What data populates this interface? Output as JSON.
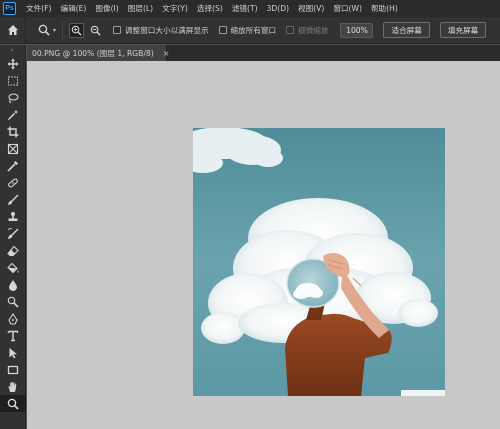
{
  "app": {
    "logo_text": "Ps"
  },
  "menu": {
    "items": [
      {
        "label": "文件(F)"
      },
      {
        "label": "编辑(E)"
      },
      {
        "label": "图像(I)"
      },
      {
        "label": "图层(L)"
      },
      {
        "label": "文字(Y)"
      },
      {
        "label": "选择(S)"
      },
      {
        "label": "滤镜(T)"
      },
      {
        "label": "3D(D)"
      },
      {
        "label": "视图(V)"
      },
      {
        "label": "窗口(W)"
      },
      {
        "label": "帮助(H)"
      }
    ]
  },
  "options": {
    "checkbox_resize": "调整窗口大小以满屏显示",
    "checkbox_zoom_all": "缩放所有窗口",
    "checkbox_scrubby": "细微缩放",
    "zoom_percent": "100%",
    "fit_screen": "适合屏幕",
    "fill_screen": "填充屏幕"
  },
  "document": {
    "tab_title": "00.PNG @ 100% (图层 1, RGB/8)",
    "tab_close": "×"
  },
  "tools": [
    "move-tool-icon",
    "marquee-tool-icon",
    "lasso-tool-icon",
    "magic-wand-tool-icon",
    "crop-tool-icon",
    "frame-tool-icon",
    "eyedropper-tool-icon",
    "healing-brush-tool-icon",
    "brush-tool-icon",
    "clone-stamp-tool-icon",
    "history-brush-tool-icon",
    "eraser-tool-icon",
    "paint-bucket-tool-icon",
    "blur-tool-icon",
    "dodge-tool-icon",
    "pen-tool-icon",
    "type-tool-icon",
    "path-selection-tool-icon",
    "rectangle-tool-icon",
    "hand-tool-icon",
    "zoom-tool-icon"
  ],
  "colors": {
    "accent": "#31a8ff",
    "sky": "#5e9aa6",
    "shirt": "#8a3f1c"
  }
}
